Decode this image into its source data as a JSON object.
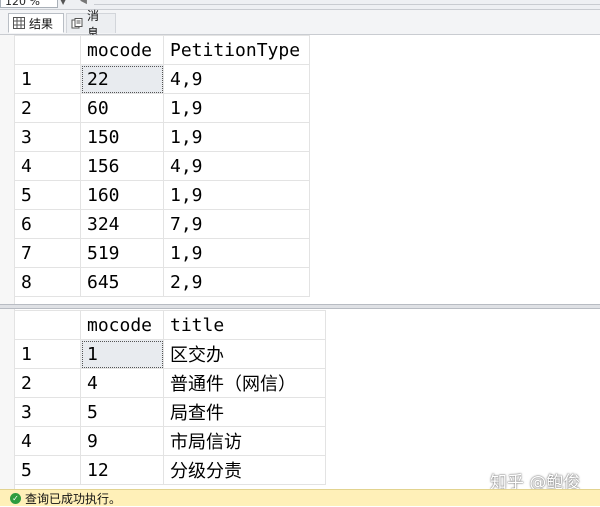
{
  "zoom": {
    "level": "120 %"
  },
  "tabs": [
    {
      "label": "结果"
    },
    {
      "label": "消息"
    }
  ],
  "grid1": {
    "columns": [
      "",
      "mocode",
      "PetitionType"
    ],
    "rows": [
      [
        "1",
        "22",
        "4,9"
      ],
      [
        "2",
        "60",
        "1,9"
      ],
      [
        "3",
        "150",
        "1,9"
      ],
      [
        "4",
        "156",
        "4,9"
      ],
      [
        "5",
        "160",
        "1,9"
      ],
      [
        "6",
        "324",
        "7,9"
      ],
      [
        "7",
        "519",
        "1,9"
      ],
      [
        "8",
        "645",
        "2,9"
      ]
    ]
  },
  "grid2": {
    "columns": [
      "",
      "mocode",
      "title"
    ],
    "rows": [
      [
        "1",
        "1",
        "区交办"
      ],
      [
        "2",
        "4",
        "普通件（网信）"
      ],
      [
        "3",
        "5",
        "局查件"
      ],
      [
        "4",
        "9",
        "市局信访"
      ],
      [
        "5",
        "12",
        "分级分责"
      ]
    ]
  },
  "watermark": "知乎 @鲍俊",
  "status": {
    "text": "查询已成功执行。",
    "icon": "check-circle-icon"
  }
}
